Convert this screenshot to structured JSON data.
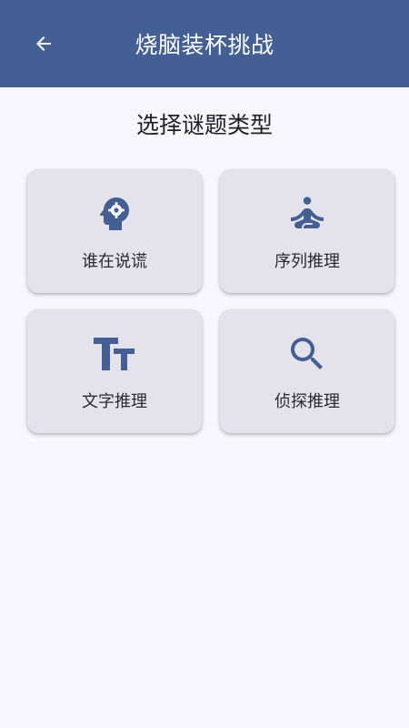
{
  "app_bar": {
    "title": "烧脑装杯挑战",
    "back_icon": "arrow-back-icon",
    "background": "#445f94"
  },
  "section": {
    "title": "选择谜题类型"
  },
  "categories": [
    {
      "label": "谁在说谎",
      "icon": "head-gear-icon"
    },
    {
      "label": "序列推理",
      "icon": "meditation-icon"
    },
    {
      "label": "文字推理",
      "icon": "text-size-icon"
    },
    {
      "label": "侦探推理",
      "icon": "search-icon"
    }
  ],
  "colors": {
    "accent": "#445f94",
    "card_background": "#e4e3ec",
    "page_background": "#f7f7fd"
  }
}
